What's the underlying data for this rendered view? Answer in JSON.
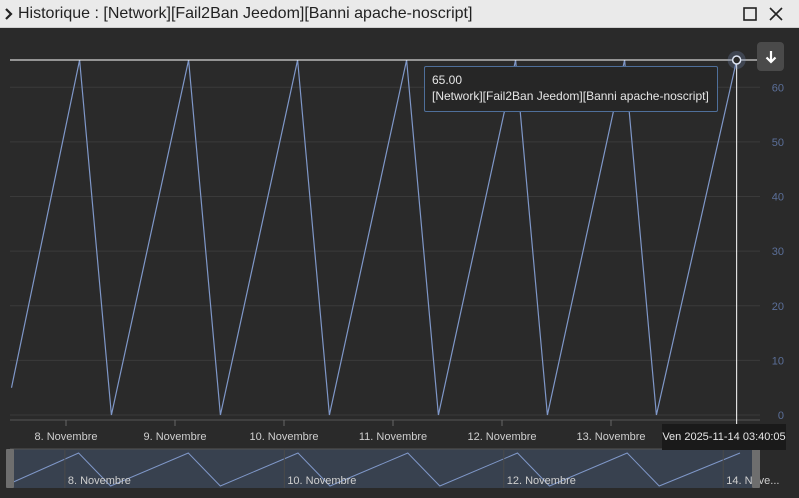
{
  "window": {
    "title": "Historique : [Network][Fail2Ban Jeedom][Banni apache-noscript]",
    "collapse_icon": "chevron-right-icon",
    "maximize_icon": "maximize-icon",
    "close_icon": "close-icon"
  },
  "toolbar": {
    "export_icon": "arrow-down-icon"
  },
  "tooltip": {
    "value": "65.00",
    "series": "[Network][Fail2Ban Jeedom][Banni apache-noscript]"
  },
  "hover_x_label": "Ven 2025-11-14 03:40:05",
  "colors": {
    "series": "#7f97c8",
    "axis_label": "#5b6f99",
    "grid": "#3a3a3a",
    "crosshair": "#ffffff",
    "navigator_mask": "#3b4556",
    "navigator_handle": "#6e6e6e"
  },
  "chart_data": {
    "type": "line",
    "title": "",
    "xlabel": "",
    "ylabel": "",
    "x_tick_labels": [
      "8. Novembre",
      "9. Novembre",
      "10. Novembre",
      "11. Novembre",
      "12. Novembre",
      "13. Novembre"
    ],
    "navigator_tick_labels": [
      "8. Novembre",
      "10. Novembre",
      "12. Novembre",
      "14. Nove..."
    ],
    "y_ticks": [
      0,
      10,
      20,
      30,
      40,
      50,
      60
    ],
    "ylim": [
      0,
      65
    ],
    "y_axis_side": "right",
    "grid": true,
    "series": [
      {
        "name": "[Network][Fail2Ban Jeedom][Banni apache-noscript]",
        "x": [
          "2025-11-07 12:00",
          "2025-11-08 03:00",
          "2025-11-08 10:00",
          "2025-11-09 03:00",
          "2025-11-09 10:00",
          "2025-11-10 03:00",
          "2025-11-10 10:00",
          "2025-11-11 03:00",
          "2025-11-11 10:00",
          "2025-11-12 03:00",
          "2025-11-12 10:00",
          "2025-11-13 03:00",
          "2025-11-13 10:00",
          "2025-11-14 03:40"
        ],
        "values": [
          5,
          65,
          0,
          65,
          0,
          65,
          0,
          65,
          0,
          65,
          0,
          65,
          0,
          65
        ]
      }
    ],
    "highlight": {
      "x": "2025-11-14 03:40",
      "value": 65
    }
  }
}
